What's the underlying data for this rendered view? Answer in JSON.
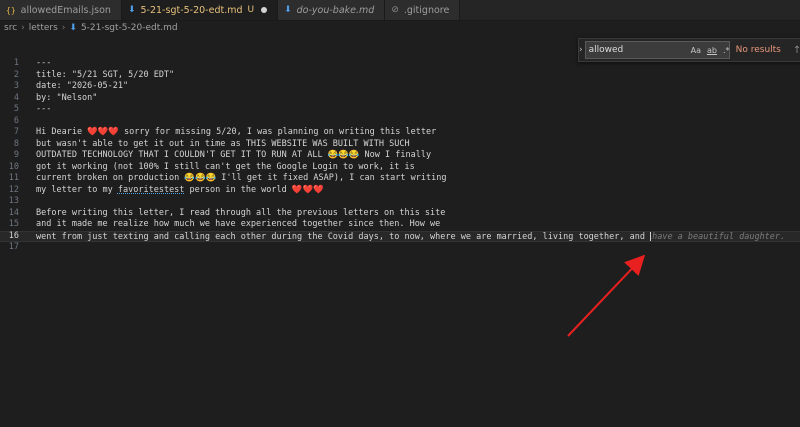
{
  "tabs": [
    {
      "icon": "{}",
      "label": "allowedEmails.json",
      "kind": "json"
    },
    {
      "icon": "⬇",
      "label": "5-21-sgt-5-20-edt.md",
      "status": "U",
      "kind": "md",
      "active": true
    },
    {
      "icon": "⬇",
      "label": "do-you-bake.md",
      "kind": "md"
    },
    {
      "icon": "⊘",
      "label": ".gitignore",
      "kind": "git"
    }
  ],
  "breadcrumb": [
    "src",
    "letters",
    "5-21-sgt-5-20-edt.md"
  ],
  "find": {
    "value": "allowed",
    "opt_case": "Aa",
    "opt_word": "ab",
    "opt_regex": ".*",
    "result": "No results",
    "up": "↑"
  },
  "editor": {
    "lines": [
      {
        "n": "1",
        "t": "---"
      },
      {
        "n": "2",
        "t": "title: \"5/21 SGT, 5/20 EDT\""
      },
      {
        "n": "3",
        "t": "date: \"2026-05-21\""
      },
      {
        "n": "4",
        "t": "by: \"Nelson\""
      },
      {
        "n": "5",
        "t": "---"
      },
      {
        "n": "6",
        "t": ""
      },
      {
        "n": "7",
        "t": "Hi Dearie ❤️❤️❤️ sorry for missing 5/20, I was planning on writing this letter"
      },
      {
        "n": "8",
        "t": "but wasn't able to get it out in time as THIS WEBSITE WAS BUILT WITH SUCH"
      },
      {
        "n": "9",
        "t": "OUTDATED TECHNOLOGY THAT I COULDN'T GET IT TO RUN AT ALL 😂😂😂 Now I finally"
      },
      {
        "n": "10",
        "t": "got it working (not 100% I still can't get the Google Login to work, it is"
      },
      {
        "n": "11",
        "t": "current broken on production 😂😂😂 I'll get it fixed ASAP), I can start writing"
      },
      {
        "n": "12",
        "a": "my letter to my ",
        "b": "favoritestest",
        "c": " person in the world ❤️❤️❤️"
      },
      {
        "n": "13",
        "t": ""
      },
      {
        "n": "14",
        "t": "Before writing this letter, I read through all the previous letters on this site"
      },
      {
        "n": "15",
        "t": "and it made me realize how much we have experienced together since then. How we"
      },
      {
        "n": "16",
        "t": "went from just texting and calling each other during the Covid days, to now, where we are married, living together, and ",
        "ghost": "have a beautiful daughter."
      },
      {
        "n": "17",
        "t": ""
      }
    ]
  }
}
